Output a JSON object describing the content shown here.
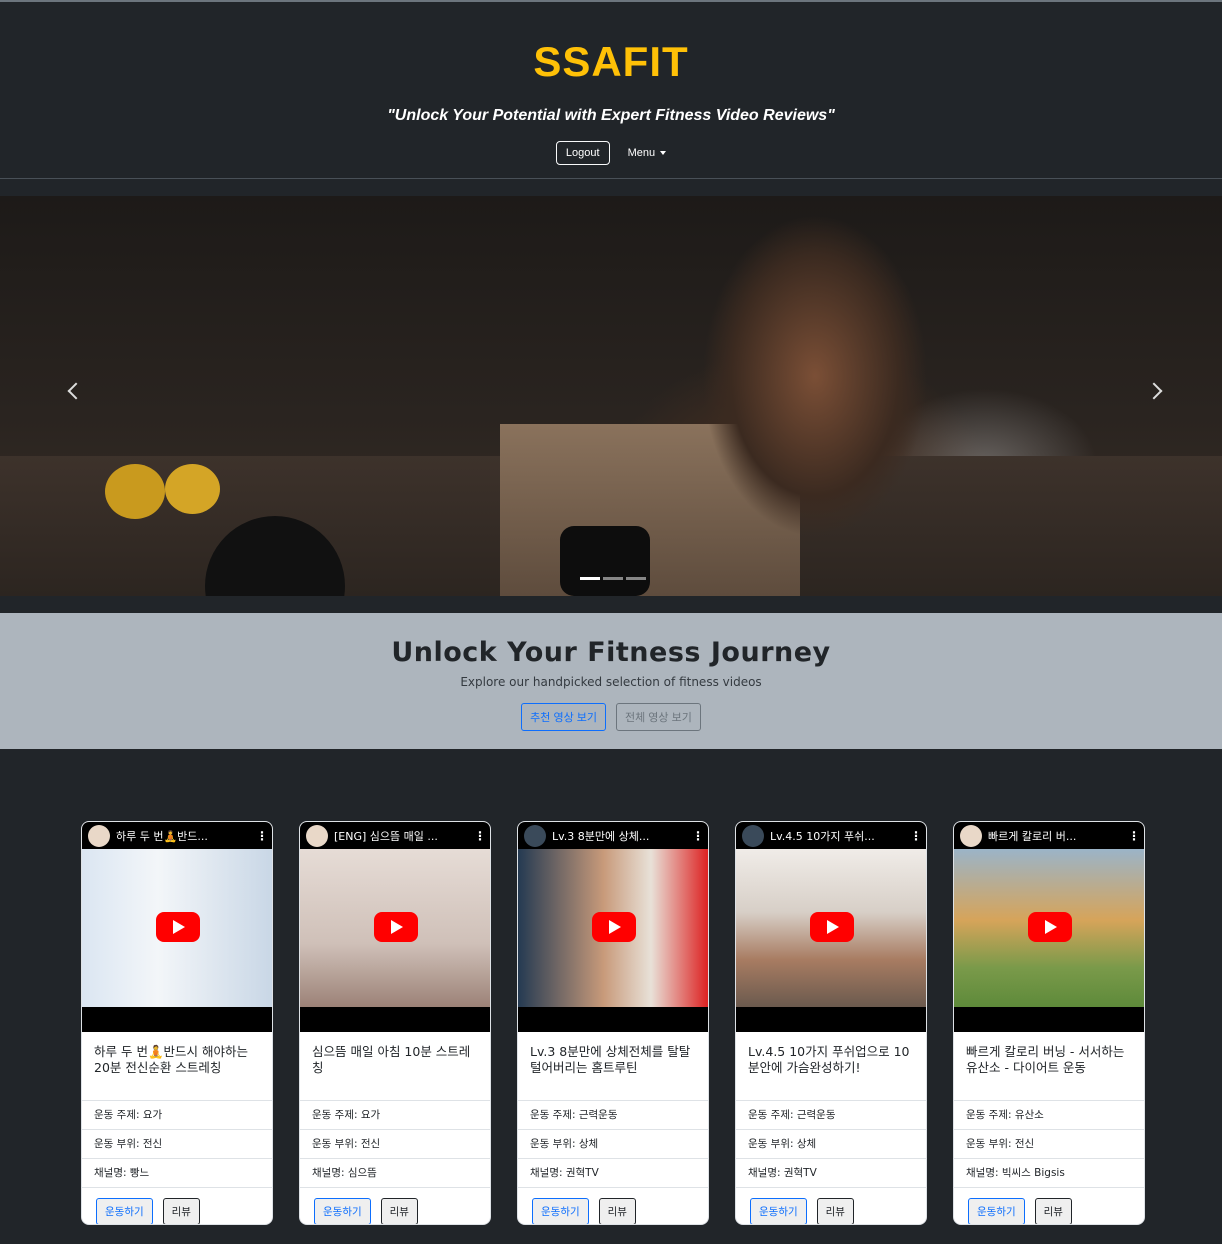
{
  "header": {
    "brand": "SSAFIT",
    "tagline": "\"Unlock Your Potential with Expert Fitness Video Reviews\"",
    "logout_label": "Logout",
    "menu_label": "Menu"
  },
  "hero": {
    "title": "Unlock Your Fitness Journey",
    "subtitle": "Explore our handpicked selection of fitness videos",
    "recommended_button": "추천 영상 보기",
    "all_button": "전체 영상 보기"
  },
  "colors": {
    "brand": "#ffc107",
    "background": "#212529",
    "hero_background": "#adb5bd",
    "primary": "#0d6efd"
  },
  "videos": [
    {
      "yt_title": "하루 두 번🧘반드...",
      "title": "하루 두 번🧘반드시 해야하는 20분 전신순환 스트레칭",
      "part_type": "운동 주제: 요가",
      "part": "운동 부위: 전신",
      "channel": "채널명: 빵느",
      "exercise_button": "운동하기",
      "review_button": "리뷰"
    },
    {
      "yt_title": "[ENG] 심으뜸 매일 ...",
      "title": "심으뜸 매일 아침 10분 스트레칭",
      "part_type": "운동 주제: 요가",
      "part": "운동 부위: 전신",
      "channel": "채널명: 심으뜸",
      "exercise_button": "운동하기",
      "review_button": "리뷰"
    },
    {
      "yt_title": "Lv.3 8분만에 상체...",
      "title": "Lv.3 8분만에 상체전체를 탈탈 털어버리는 홈트루틴",
      "part_type": "운동 주제: 근력운동",
      "part": "운동 부위: 상체",
      "channel": "채널명: 권혁TV",
      "exercise_button": "운동하기",
      "review_button": "리뷰"
    },
    {
      "yt_title": "Lv.4.5 10가지 푸쉬...",
      "title": "Lv.4.5 10가지 푸쉬업으로 10분안에 가슴완성하기!",
      "part_type": "운동 주제: 근력운동",
      "part": "운동 부위: 상체",
      "channel": "채널명: 권혁TV",
      "exercise_button": "운동하기",
      "review_button": "리뷰"
    },
    {
      "yt_title": "빠르게 칼로리 버...",
      "title": "빠르게 칼로리 버닝 - 서서하는 유산소 - 다이어트 운동",
      "part_type": "운동 주제: 유산소",
      "part": "운동 부위: 전신",
      "channel": "채널명: 빅씨스 Bigsis",
      "exercise_button": "운동하기",
      "review_button": "리뷰"
    }
  ]
}
